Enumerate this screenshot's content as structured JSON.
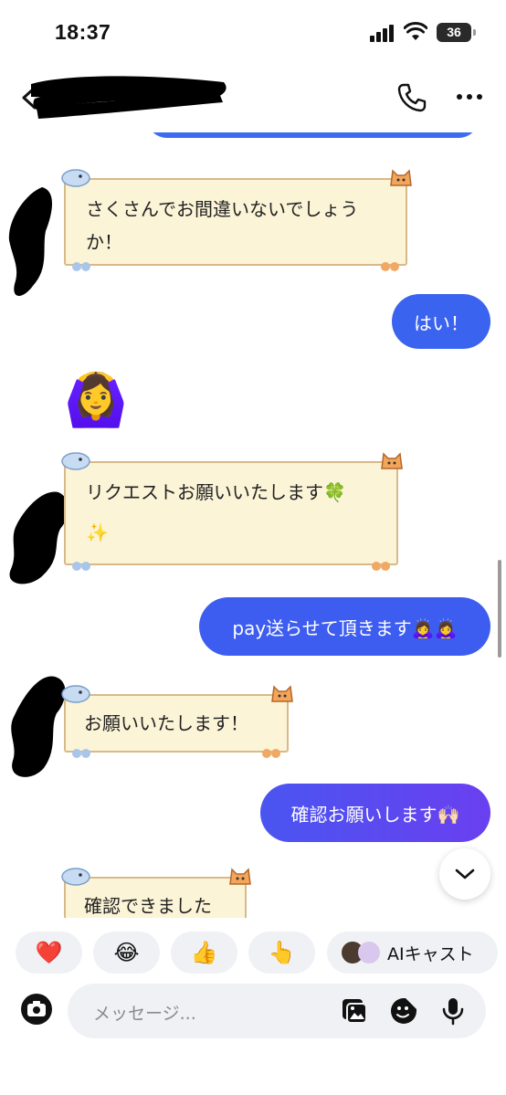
{
  "status_bar": {
    "time": "18:37",
    "battery": "36"
  },
  "header": {
    "icons": [
      "back-icon",
      "phone-icon",
      "more-icon"
    ]
  },
  "messages": [
    {
      "from": "other",
      "text_line1": "さくさんでお間違いないでしょう",
      "text_line2": "か！"
    },
    {
      "from": "me",
      "text": "はい！"
    },
    {
      "from": "other",
      "emoji": "🙆‍♀️"
    },
    {
      "from": "other",
      "text_line1": "リクエストお願いいたします🍀",
      "text_line2": "✨"
    },
    {
      "from": "me",
      "text": "pay送らせて頂きます🙇‍♀️🙇‍♀️"
    },
    {
      "from": "other",
      "text": "お願いいたします！"
    },
    {
      "from": "me",
      "text": "確認お願いします🙌🏻"
    },
    {
      "from": "other",
      "text": "確認できました"
    }
  ],
  "quick_reactions": [
    "❤️",
    "😂",
    "👍",
    "👆"
  ],
  "ai_cast_label": "AIキャスト",
  "composer": {
    "placeholder": "メッセージ..."
  },
  "colors": {
    "bubble_blue": "#3a63ef",
    "bubble_purple": "#5a44ee",
    "card_bg": "#fbf4d7",
    "card_border": "#d8b98a"
  }
}
